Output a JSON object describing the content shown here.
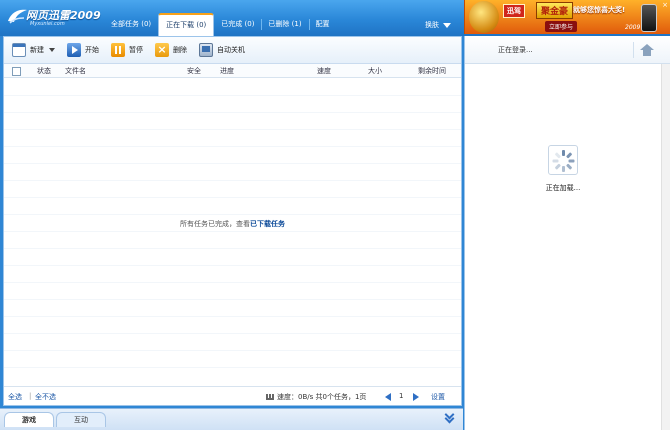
{
  "app": {
    "logo_text": "网页迅雷2009",
    "logo_sub": "Myxunlei.com"
  },
  "tabs": [
    {
      "label": "全部任务 (0)",
      "active": false
    },
    {
      "label": "正在下载 (0)",
      "active": true
    },
    {
      "label": "已完成 (0)",
      "active": false
    },
    {
      "label": "已删除 (1)",
      "active": false
    },
    {
      "label": "配置",
      "active": false
    }
  ],
  "skin_label": "换肤",
  "ad": {
    "brand": "迅驾",
    "gold": "聚金豪",
    "slogan": "就够您惊喜大奖!",
    "join": "立即参与",
    "year": "2009",
    "close": "×"
  },
  "toolbar": {
    "new_label": "新建",
    "start_label": "开始",
    "pause_label": "暂停",
    "delete_label": "删除",
    "shutdown_label": "自动关机"
  },
  "columns": {
    "status": "状态",
    "filename": "文件名",
    "security": "安全",
    "progress": "进度",
    "speed": "速度",
    "size": "大小",
    "time_left": "剩余时间"
  },
  "empty_message": {
    "text": "所有任务已完成，查看",
    "link": "已下载任务"
  },
  "status_bar": {
    "select_all": "全选",
    "separator": "|",
    "select_none": "全不选",
    "summary": "速度：0B/s 共0个任务，1页",
    "page": "1",
    "settings": "设置"
  },
  "bottom_tabs": [
    {
      "label": "游戏",
      "active": true
    },
    {
      "label": "互动",
      "active": false
    }
  ],
  "right_panel": {
    "login_text": "正在登录...",
    "loading_text": "正在加载..."
  },
  "colors": {
    "header_blue": "#2a87d8",
    "active_tab_accent": "#f7a11a",
    "link_blue": "#1a56a6"
  },
  "icons": [
    "xunlei-logo-icon",
    "new-task-icon",
    "start-icon",
    "pause-icon",
    "delete-icon",
    "shutdown-icon",
    "home-icon",
    "loading-spinner-icon",
    "collapse-icon"
  ]
}
